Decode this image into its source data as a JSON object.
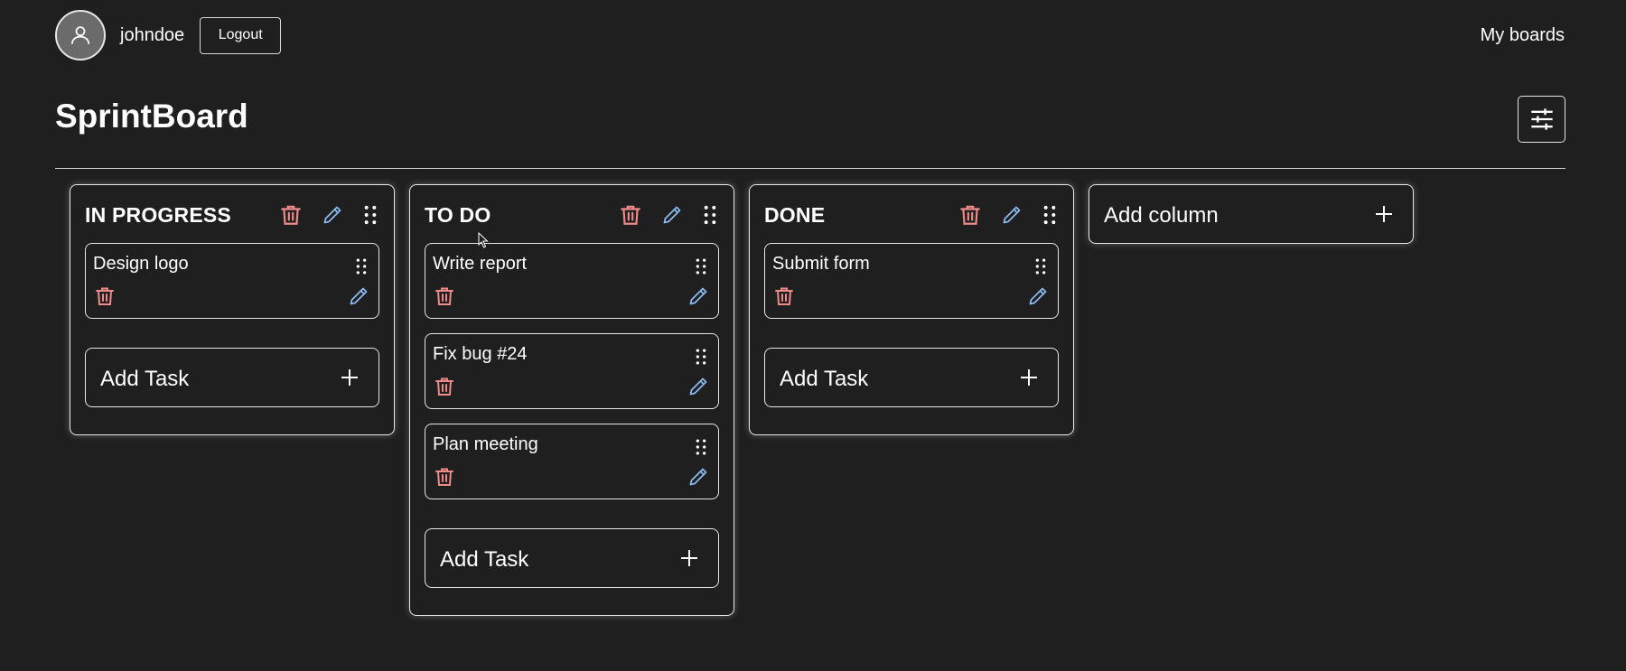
{
  "header": {
    "username": "johndoe",
    "logout_label": "Logout",
    "my_boards_label": "My boards",
    "avatar_icon": "user-icon"
  },
  "board": {
    "title": "SprintBoard",
    "settings_icon": "sliders-icon"
  },
  "columns": [
    {
      "title": "IN PROGRESS",
      "tasks": [
        {
          "name": "Design logo"
        }
      ],
      "add_task_label": "Add Task"
    },
    {
      "title": "TO DO",
      "tasks": [
        {
          "name": "Write report"
        },
        {
          "name": "Fix bug #24"
        },
        {
          "name": "Plan meeting"
        }
      ],
      "add_task_label": "Add Task"
    },
    {
      "title": "DONE",
      "tasks": [
        {
          "name": "Submit form"
        }
      ],
      "add_task_label": "Add Task"
    }
  ],
  "add_column_label": "Add column",
  "colors": {
    "background": "#1f1f1f",
    "delete": "#ef8a8a",
    "edit": "#8ab8ef",
    "border": "#e6e6e6"
  }
}
